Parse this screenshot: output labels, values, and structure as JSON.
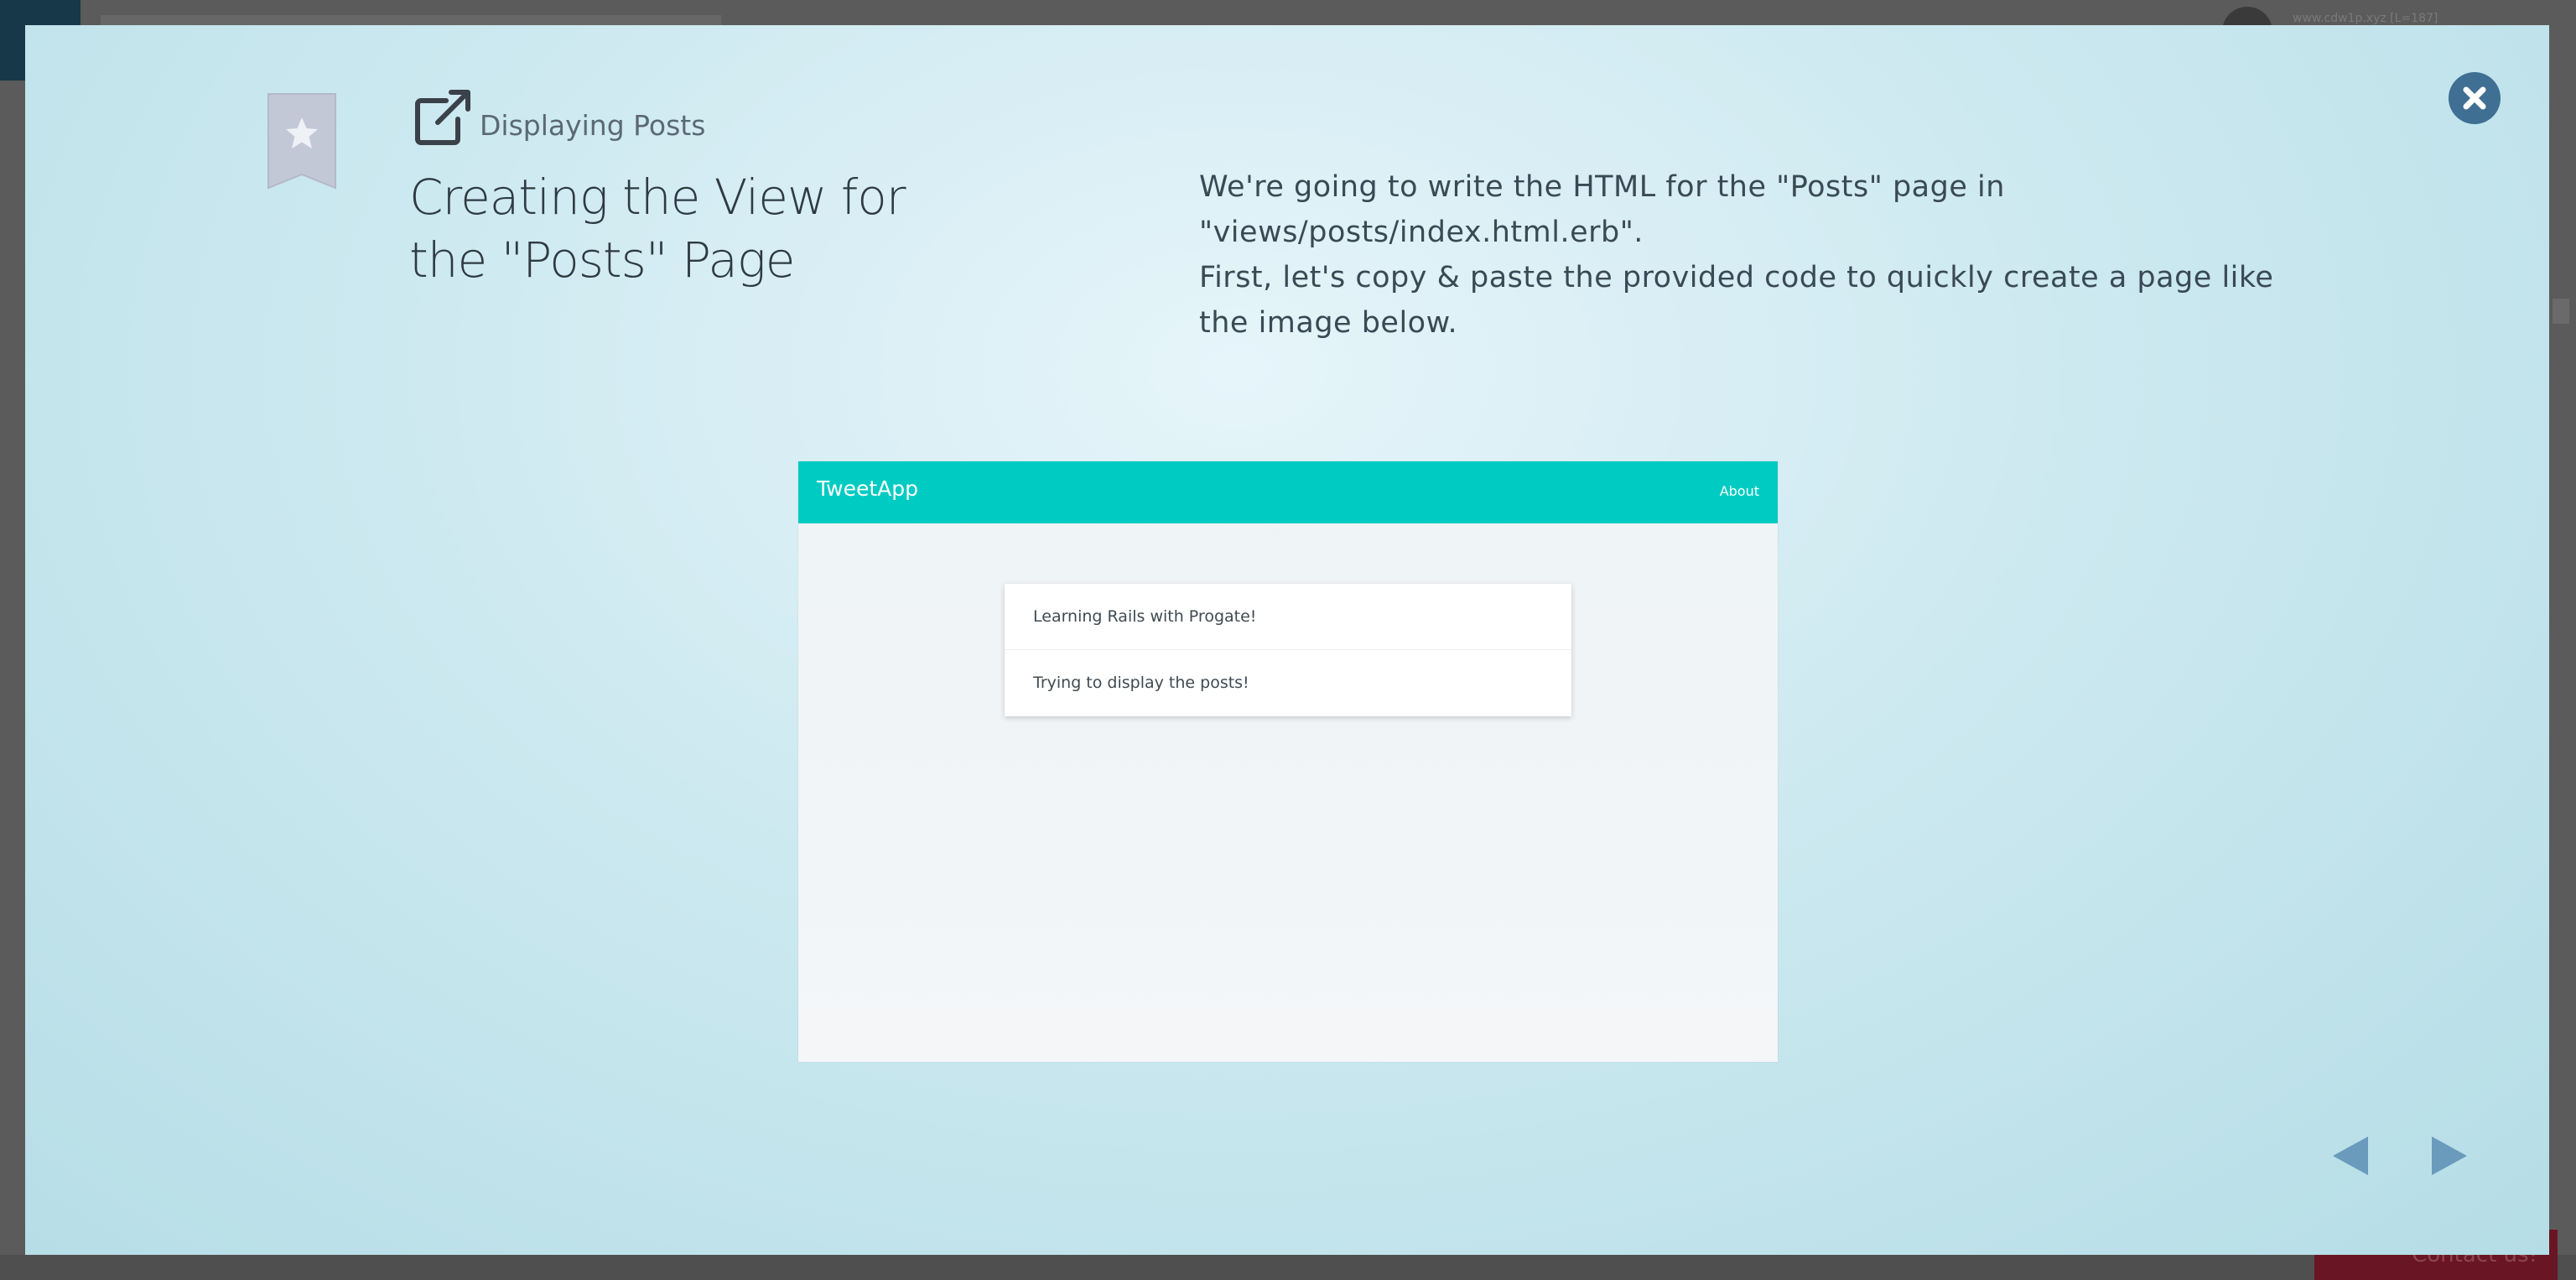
{
  "background": {
    "user_label": "www.cdw1p.xyz [L=187]",
    "contact_label": "Contact us!"
  },
  "modal": {
    "close_icon": "close-icon",
    "bookmark_icon": "bookmark-star-icon",
    "chapter": {
      "icon": "external-link-icon",
      "label": "Displaying Posts"
    },
    "title": "Creating the View for the \"Posts\" Page",
    "description": [
      "We're going to write the HTML for the \"Posts\" page in \"views/posts/index.html.erb\".",
      "First, let's copy & paste the provided code to quickly create a page like the image below."
    ],
    "screenshot": {
      "logo": "TweetApp",
      "nav_link": "About",
      "posts": [
        "Learning Rails with Progate!",
        "Trying to display the posts!"
      ]
    },
    "navigation": {
      "prev_icon": "arrow-left-icon",
      "next_icon": "arrow-right-icon"
    }
  },
  "colors": {
    "accent": "#3f6f93",
    "tweetapp_header": "#00cbc2",
    "bookmark": "#c3c8d6"
  }
}
